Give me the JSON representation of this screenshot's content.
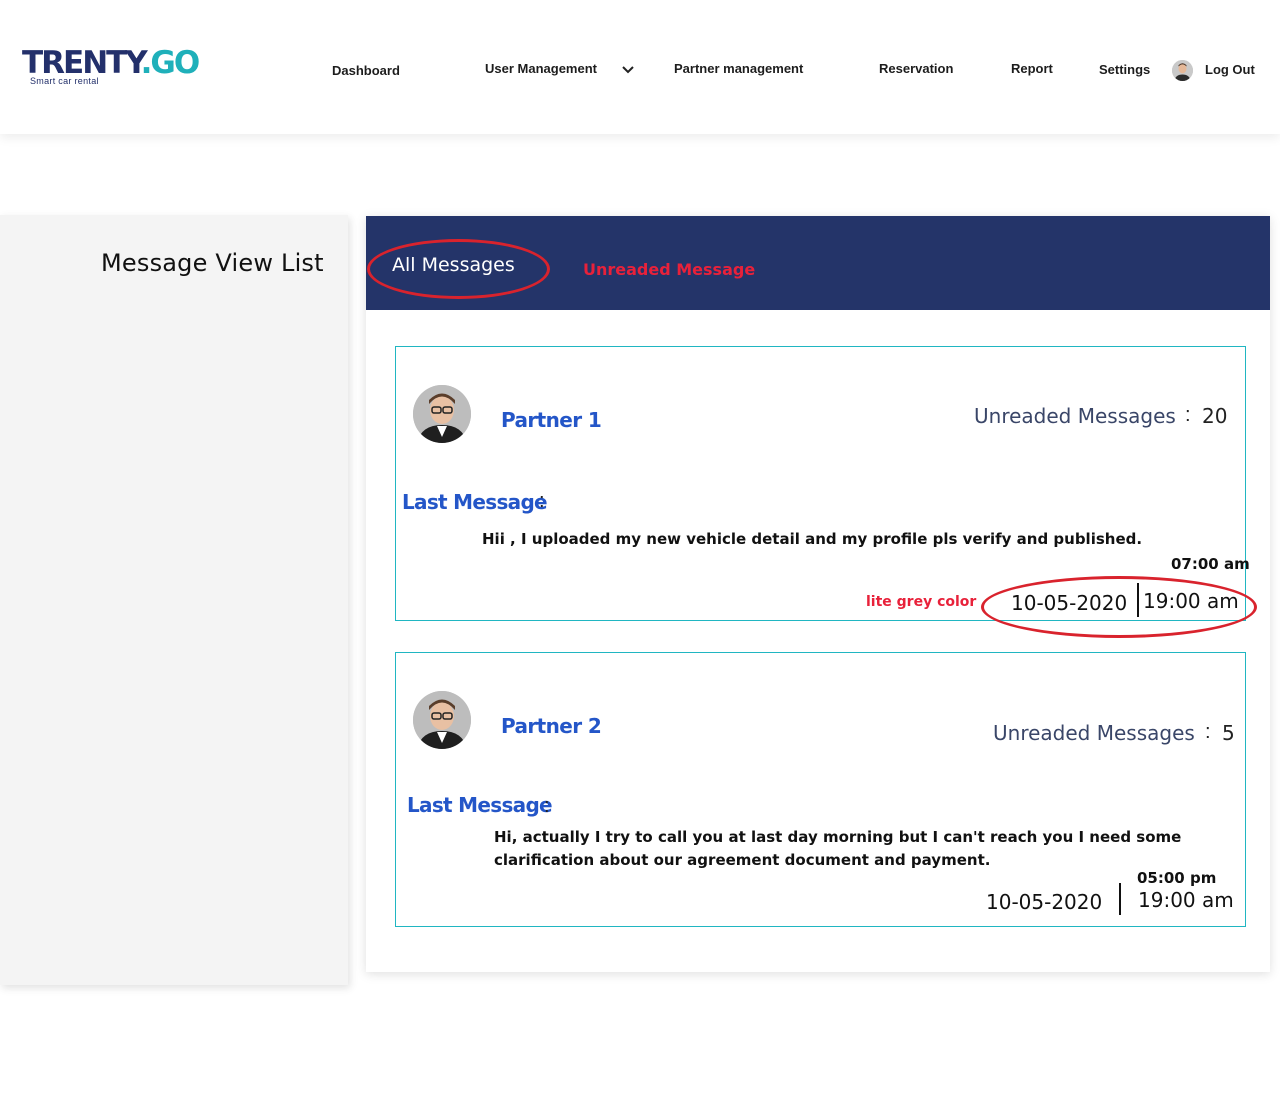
{
  "brand": {
    "name_part1": "TRENTY",
    "name_part2": ".GO",
    "tagline": "Smart car rental",
    "primary_color": "#23306b",
    "accent_color": "#1fb0ba"
  },
  "nav": {
    "dashboard": "Dashboard",
    "user_management": "User Management",
    "partner_management": "Partner management",
    "reservation": "Reservation",
    "report": "Report",
    "settings": "Settings",
    "logout": "Log Out"
  },
  "sidebar": {
    "title": "Message  View List"
  },
  "tabs": {
    "all": "All Messages",
    "unread": "Unreaded Message"
  },
  "colors": {
    "tabbar": "#243469",
    "card_border": "#20b6c2",
    "link_blue": "#2456c8",
    "annotation_red": "#d9232d"
  },
  "messages": [
    {
      "partner": "Partner 1",
      "unread_label": "Unreaded Messages",
      "unread_sep": ":",
      "unread_count": "20",
      "last_label": "Last Message",
      "last_colon": ":",
      "text": "Hii , I uploaded my new vehicle detail and my profile pls verify and published.",
      "small_time": "07:00 am",
      "date": "10-05-2020",
      "time": "19:00 am",
      "note": "lite grey color"
    },
    {
      "partner": "Partner 2",
      "unread_label": "Unreaded Messages",
      "unread_sep": ":",
      "unread_count": "5",
      "last_label": "Last Message",
      "last_colon": ":",
      "text_line1": "Hi, actually I try to call you at last day morning but I can't  reach you I need some",
      "text_line2": "clarification about our agreement document and payment.",
      "small_time": "05:00 pm",
      "date": "10-05-2020",
      "time": "19:00 am"
    }
  ]
}
